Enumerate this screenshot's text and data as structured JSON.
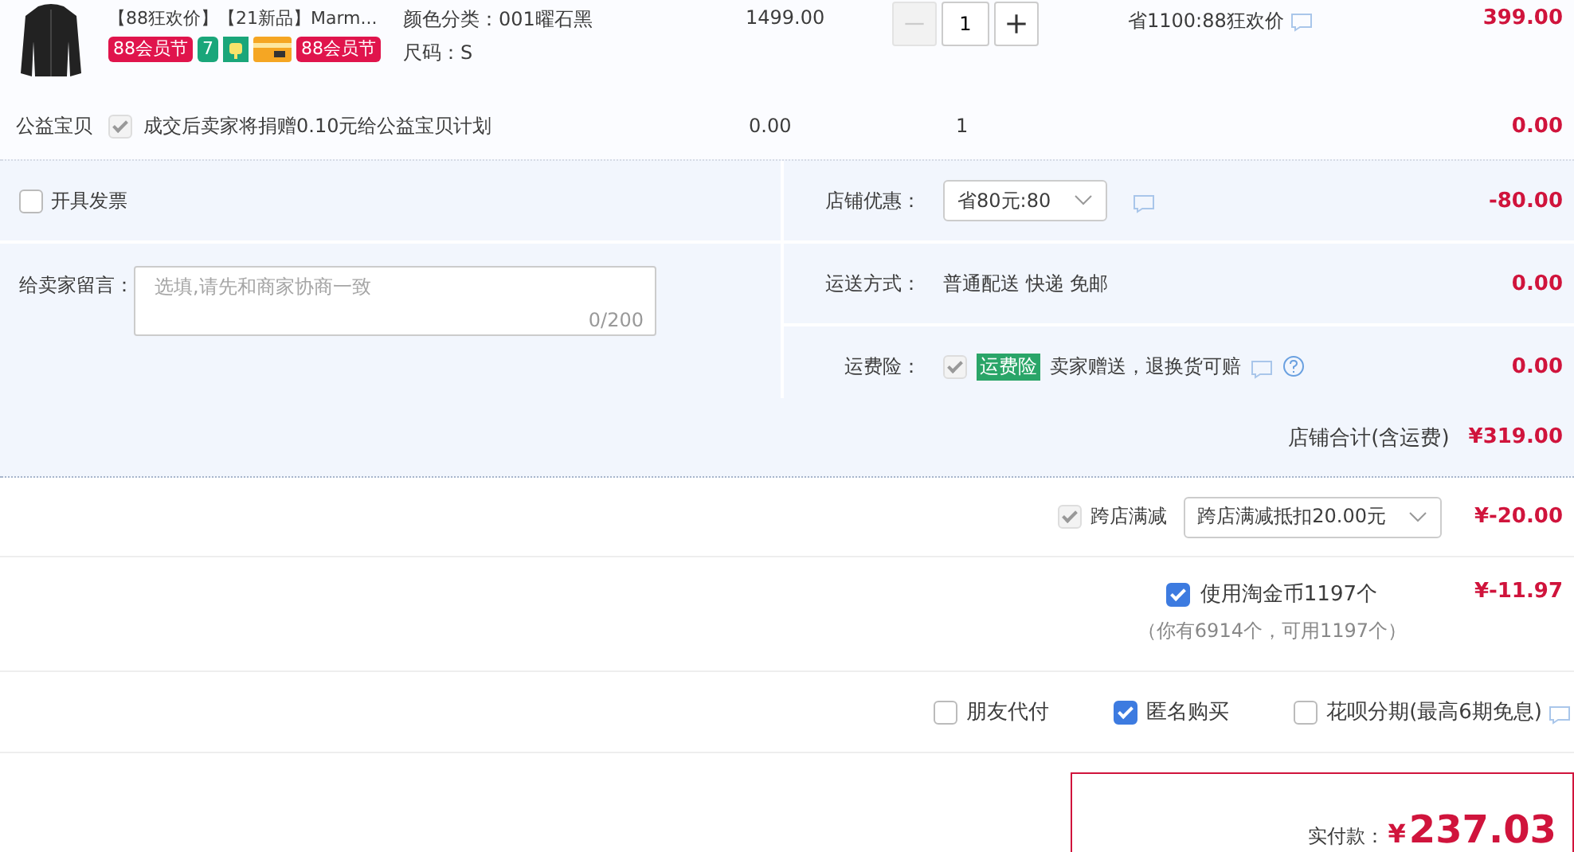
{
  "product": {
    "title": "【88狂欢价】【21新品】Marm...",
    "badges": [
      {
        "kind": "text",
        "text": "88会员节",
        "color": "#e0144c"
      },
      {
        "kind": "text",
        "text": "7",
        "color": "#1aa67a"
      },
      {
        "kind": "bag",
        "color": "#1aa67a"
      },
      {
        "kind": "card",
        "color": "#f5a623"
      },
      {
        "kind": "text",
        "text": "88会员节",
        "color": "#e0144c"
      }
    ],
    "sku": [
      "颜色分类：001曜石黑",
      "尺码：S"
    ],
    "price": "1499.00",
    "quantity": "1",
    "minus_disabled": true,
    "promo": "省1100:88狂欢价",
    "subtotal": "399.00"
  },
  "charity": {
    "label": "公益宝贝",
    "checked": true,
    "disabled": true,
    "text": "成交后卖家将捐赠0.10元给公益宝贝计划",
    "price": "0.00",
    "quantity": "1",
    "subtotal": "0.00"
  },
  "invoice": {
    "label": "开具发票",
    "checked": false
  },
  "message": {
    "label": "给卖家留言：",
    "placeholder": "选填,请先和商家协商一致",
    "counter": "0/200"
  },
  "shop_rows": [
    {
      "kind": "select",
      "label": "店铺优惠：",
      "value": "省80元:80",
      "amount": "-80.00"
    },
    {
      "kind": "text",
      "label": "运送方式：",
      "value": "普通配送 快递 免邮",
      "amount": "0.00"
    },
    {
      "kind": "insurance",
      "label": "运费险：",
      "checked": true,
      "disabled": true,
      "tag": "运费险",
      "value": "卖家赠送，退换货可赔",
      "amount": "0.00"
    }
  ],
  "shop_total": {
    "label": "店铺合计(含运费)",
    "amount": "¥319.00"
  },
  "cross_store": {
    "label": "跨店满减",
    "checked": true,
    "disabled": true,
    "select": "跨店满减抵扣20.00元",
    "amount": "¥-20.00"
  },
  "coins": {
    "label": "使用淘金币1197个",
    "checked": true,
    "note": "（你有6914个，可用1197个）",
    "amount": "¥-11.97"
  },
  "options": [
    {
      "label": "朋友代付",
      "checked": false
    },
    {
      "label": "匿名购买",
      "checked": true
    },
    {
      "label": "花呗分期(最高6期免息)",
      "checked": false
    }
  ],
  "total": {
    "label": "实付款：",
    "currency": "¥",
    "amount": "237.03"
  }
}
